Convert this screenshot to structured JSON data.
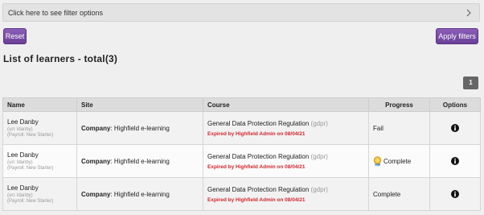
{
  "filter_bar": {
    "label": "Click here to see filter options"
  },
  "buttons": {
    "reset": "Reset",
    "apply": "Apply filters"
  },
  "heading": "List of learners - total(3)",
  "pagination": {
    "page": "1"
  },
  "colors": {
    "accent": "#7b4fa8",
    "expired": "#d4272d",
    "page_box": "#666666"
  },
  "table": {
    "headers": {
      "name": "Name",
      "site": "Site",
      "course": "Course",
      "progress": "Progress",
      "options": "Options"
    },
    "rows": [
      {
        "name": "Lee Danby",
        "username": "(un: ldanby)",
        "payroll": "(Payroll: New Starter)",
        "site_label": "Company",
        "site_value": ": Highfield e-learning",
        "course": "General Data Protection Regulation",
        "course_code": "(gdpr)",
        "expired": "Expired by Highfield Admin on 08/04/21",
        "progress": "Fail",
        "has_medal": false,
        "options_icon": "info-icon"
      },
      {
        "name": "Lee Danby",
        "username": "(un: ldanby)",
        "payroll": "(Payroll: New Starter)",
        "site_label": "Company",
        "site_value": ": Highfield e-learning",
        "course": "General Data Protection Regulation",
        "course_code": "(gdpr)",
        "expired": "Expired by Highfield Admin on 08/04/21",
        "progress": "Complete",
        "has_medal": true,
        "options_icon": "info-icon"
      },
      {
        "name": "Lee Danby",
        "username": "(un: ldanby)",
        "payroll": "(Payroll: New Starter)",
        "site_label": "Company",
        "site_value": ": Highfield e-learning",
        "course": "General Data Protection Regulation",
        "course_code": "(gdpr)",
        "expired": "Expired by Highfield Admin on 08/04/21",
        "progress": "Complete",
        "has_medal": false,
        "options_icon": "info-icon"
      }
    ]
  }
}
